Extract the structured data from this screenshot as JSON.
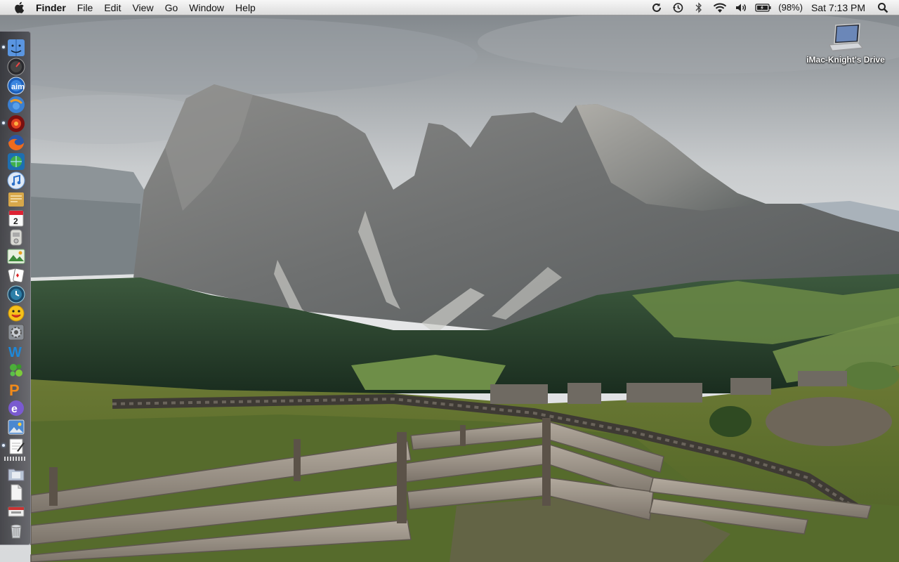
{
  "menubar": {
    "apple_icon": "apple-icon",
    "app_name": "Finder",
    "menus": [
      "File",
      "Edit",
      "View",
      "Go",
      "Window",
      "Help"
    ],
    "status_icons": [
      "sync-icon",
      "time-machine-icon",
      "bluetooth-icon",
      "wifi-icon",
      "volume-icon",
      "battery-icon"
    ],
    "battery_percent": "(98%)",
    "clock": "Sat 7:13 PM",
    "spotlight_icon": "spotlight-icon"
  },
  "desktop": {
    "drive_label": "iMac-Knight's Drive",
    "drive_icon": "laptop-drive-icon"
  },
  "dock": {
    "orientation": "left",
    "items": [
      {
        "icon": "finder-icon",
        "running": true
      },
      {
        "icon": "dashboard-icon",
        "running": false
      },
      {
        "icon": "aim-icon",
        "running": false
      },
      {
        "icon": "globe-browser-icon",
        "running": false
      },
      {
        "icon": "red-app-icon",
        "running": true
      },
      {
        "icon": "firefox-icon",
        "running": false
      },
      {
        "icon": "globe-app-icon",
        "running": false
      },
      {
        "icon": "itunes-icon",
        "running": false
      },
      {
        "icon": "mail-envelope-icon",
        "running": false
      },
      {
        "icon": "ical-calendar-icon",
        "running": false
      },
      {
        "icon": "notepad-icon",
        "running": false
      },
      {
        "icon": "photo-app-icon",
        "running": false
      },
      {
        "icon": "playing-cards-icon",
        "running": false
      },
      {
        "icon": "time-machine-dock-icon",
        "running": false
      },
      {
        "icon": "chat-smiley-icon",
        "running": false
      },
      {
        "icon": "system-preferences-icon",
        "running": false
      },
      {
        "icon": "blue-w-app-icon",
        "running": false
      },
      {
        "icon": "green-app-icon",
        "running": false
      },
      {
        "icon": "orange-p-app-icon",
        "running": false
      },
      {
        "icon": "purple-e-app-icon",
        "running": false
      },
      {
        "icon": "iphoto-icon",
        "running": false
      },
      {
        "icon": "textedit-icon",
        "running": true
      },
      {
        "icon": "applications-folder-icon",
        "running": false
      },
      {
        "icon": "document-stack-icon",
        "running": false
      },
      {
        "icon": "downloads-stack-icon",
        "running": false
      },
      {
        "icon": "trash-icon",
        "running": false
      }
    ]
  },
  "colors": {
    "menubar_top": "#f7f7f7",
    "menubar_bottom": "#dcdcdc",
    "sky": "#d9dcde",
    "mountain": "#7d7f80",
    "forest": "#1e3526",
    "meadow": "#6f7f3a",
    "fence_wood": "#9a9186"
  }
}
